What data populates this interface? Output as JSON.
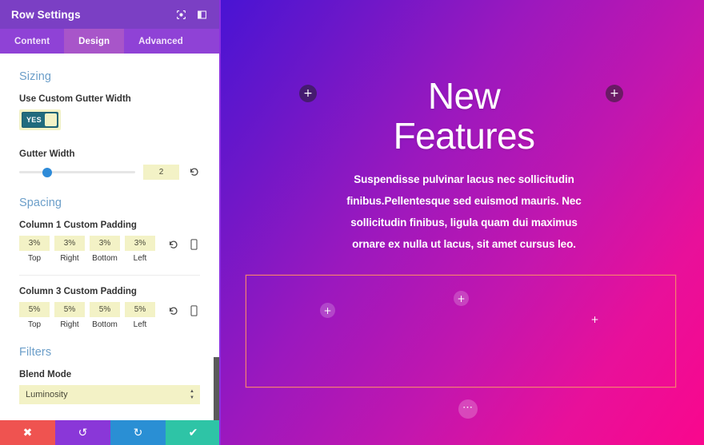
{
  "panel": {
    "title": "Row Settings",
    "header_icons": [
      {
        "name": "target-icon",
        "glyph": "⊙"
      },
      {
        "name": "layout-panel-icon",
        "glyph": "▤"
      }
    ],
    "tabs": [
      {
        "label": "Content",
        "active": false
      },
      {
        "label": "Design",
        "active": true
      },
      {
        "label": "Advanced",
        "active": false
      }
    ],
    "sections": {
      "sizing": {
        "title": "Sizing",
        "custom_gutter": {
          "label": "Use Custom Gutter Width",
          "value": "YES"
        },
        "gutter_width": {
          "label": "Gutter Width",
          "value": "2",
          "slider_percent": 24,
          "reset_icon": "undo-icon"
        }
      },
      "spacing": {
        "title": "Spacing",
        "groups": [
          {
            "label": "Column 1 Custom Padding",
            "fields": [
              {
                "value": "3%",
                "name": "Top"
              },
              {
                "value": "3%",
                "name": "Right"
              },
              {
                "value": "3%",
                "name": "Bottom"
              },
              {
                "value": "3%",
                "name": "Left"
              }
            ]
          },
          {
            "label": "Column 3 Custom Padding",
            "fields": [
              {
                "value": "5%",
                "name": "Top"
              },
              {
                "value": "5%",
                "name": "Right"
              },
              {
                "value": "5%",
                "name": "Bottom"
              },
              {
                "value": "5%",
                "name": "Left"
              }
            ]
          }
        ]
      },
      "filters": {
        "title": "Filters",
        "blend_mode": {
          "label": "Blend Mode",
          "value": "Luminosity"
        }
      }
    },
    "actions": [
      {
        "name": "cancel-button",
        "glyph": "✖",
        "color": "#ef5350"
      },
      {
        "name": "undo-button",
        "glyph": "↺",
        "color": "#8a37d8"
      },
      {
        "name": "redo-button",
        "glyph": "↻",
        "color": "#2a8fd4"
      },
      {
        "name": "save-button",
        "glyph": "✔",
        "color": "#2ec4a6"
      }
    ]
  },
  "canvas": {
    "heading_line_1": "New",
    "heading_line_2": "Features",
    "paragraph": "Suspendisse pulvinar lacus nec sollicitudin finibus.Pellentesque sed euismod mauris. Nec sollicitudin finibus, ligula quam dui maximus ornare ex nulla ut lacus, sit amet cursus leo.",
    "add_section_left": "+",
    "add_section_right": "+",
    "add_column_1": "+",
    "add_column_2": "+",
    "add_column_3": "+",
    "row_more": "⋯",
    "row_border_color": "#f4806c"
  }
}
